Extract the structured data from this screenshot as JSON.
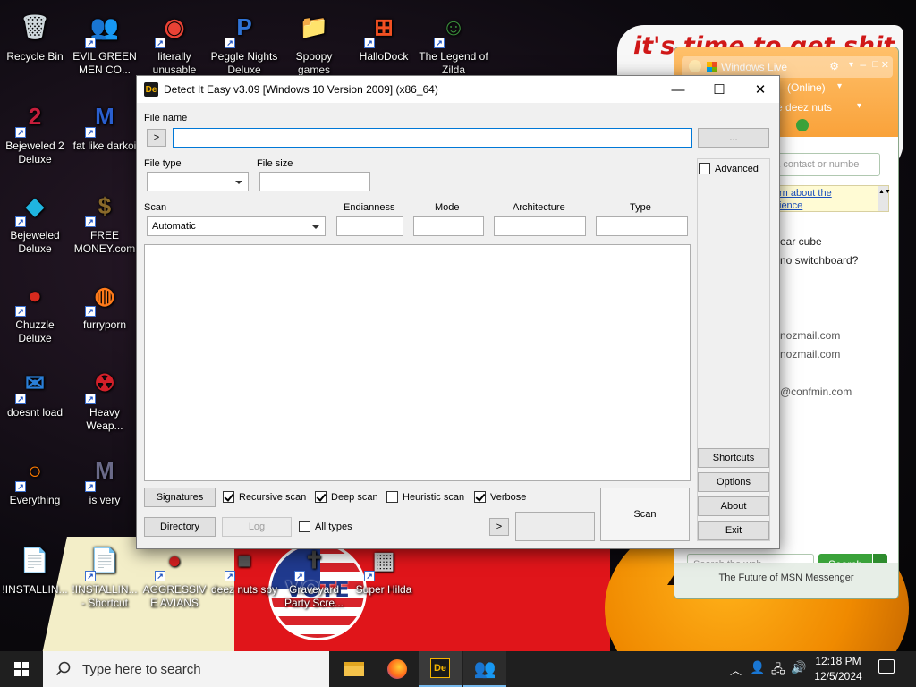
{
  "wallpaper": {
    "slogan": "it's time to get shit",
    "poster_text": "VOTE"
  },
  "desktop_icons": [
    {
      "id": "recycle-bin",
      "label": "Recycle Bin",
      "glyph": "🗑",
      "color": "#cfd8dc",
      "shortcut": false
    },
    {
      "id": "evil-green-men",
      "label": "EVIL GREEN MEN CO...",
      "glyph": "👥",
      "color": "#3cb34a",
      "shortcut": true
    },
    {
      "id": "chrome",
      "label": "literally unusable",
      "glyph": "◉",
      "color": "#e94235",
      "shortcut": true
    },
    {
      "id": "peggle",
      "label": "Peggle Nights Deluxe",
      "glyph": "P",
      "color": "#2f73d6",
      "shortcut": true
    },
    {
      "id": "spoopy",
      "label": "Spoopy games",
      "glyph": "📁",
      "color": "#e4a836",
      "shortcut": false
    },
    {
      "id": "hallodock",
      "label": "HalloDock",
      "glyph": "⊞",
      "color": "#f25022",
      "shortcut": true
    },
    {
      "id": "zilda",
      "label": "The Legend of Zilda",
      "glyph": "☺",
      "color": "#3a8d3a",
      "shortcut": true
    },
    {
      "id": "bejeweled2",
      "label": "Bejeweled 2 Deluxe",
      "glyph": "2",
      "color": "#c81e3c",
      "shortcut": true
    },
    {
      "id": "fat-like",
      "label": "fat like darkoi",
      "glyph": "M",
      "color": "#2a5fd0",
      "shortcut": true
    },
    {
      "id": "bejeweled",
      "label": "Bejeweled Deluxe",
      "glyph": "◆",
      "color": "#1fb5e0",
      "shortcut": true
    },
    {
      "id": "free-money",
      "label": "FREE MONEY.com",
      "glyph": "$",
      "color": "#8a6a2a",
      "shortcut": true
    },
    {
      "id": "chuzzle",
      "label": "Chuzzle Deluxe",
      "glyph": "●",
      "color": "#d62a1e",
      "shortcut": true
    },
    {
      "id": "furryporn",
      "label": "furryporn",
      "glyph": "◍",
      "color": "#ff7a1a",
      "shortcut": true
    },
    {
      "id": "doesnt-load",
      "label": "doesnt load",
      "glyph": "✉",
      "color": "#2a7fd8",
      "shortcut": true
    },
    {
      "id": "heavy-weap",
      "label": "Heavy Weap...",
      "glyph": "☢",
      "color": "#d4202a",
      "shortcut": true
    },
    {
      "id": "everything",
      "label": "Everything",
      "glyph": "○",
      "color": "#ff7b00",
      "shortcut": true
    },
    {
      "id": "is-very",
      "label": "is very",
      "glyph": "M",
      "color": "#6a6a88",
      "shortcut": true
    },
    {
      "id": "installing1",
      "label": "!INSTALLIN...",
      "glyph": "📄",
      "color": "#f2f2f2",
      "shortcut": false
    },
    {
      "id": "installing2",
      "label": "!INSTALLIN... - Shortcut",
      "glyph": "📄",
      "color": "#f2f2f2",
      "shortcut": true
    },
    {
      "id": "aggressive-avians",
      "label": "AGGRESSIVE AVIANS",
      "glyph": "●",
      "color": "#d42020",
      "shortcut": true
    },
    {
      "id": "deez-nuts-spy",
      "label": "deez nuts spy",
      "glyph": "■",
      "color": "#555555",
      "shortcut": true
    },
    {
      "id": "graveyard",
      "label": "Graveyard Party Scre...",
      "glyph": "✝",
      "color": "#444444",
      "shortcut": true
    },
    {
      "id": "super-hilda",
      "label": "Super Hilda",
      "glyph": "▦",
      "color": "#cfcfcf",
      "shortcut": true
    }
  ],
  "die": {
    "title": "Detect It Easy v3.09 [Windows 10 Version 2009] (x86_64)",
    "app_icon_text": "De",
    "file_name_label": "File name",
    "history_button": ">",
    "file_name_value": "",
    "browse_button": "...",
    "file_type_label": "File type",
    "file_type_value": "",
    "file_size_label": "File size",
    "file_size_value": "",
    "advanced_label": "Advanced",
    "scan_label": "Scan",
    "scan_mode_value": "Automatic",
    "endianness_label": "Endianness",
    "endianness_value": "",
    "mode_label": "Mode",
    "mode_value": "",
    "architecture_label": "Architecture",
    "architecture_value": "",
    "type_label": "Type",
    "type_value": "",
    "signatures_button": "Signatures",
    "recursive_scan": {
      "label": "Recursive scan",
      "checked": true
    },
    "deep_scan": {
      "label": "Deep scan",
      "checked": true
    },
    "heuristic_scan": {
      "label": "Heuristic scan",
      "checked": false
    },
    "verbose": {
      "label": "Verbose",
      "checked": true
    },
    "directory_button": "Directory",
    "log_button": "Log",
    "all_types": {
      "label": "All types",
      "checked": false
    },
    "progress_button": ">",
    "scan_button": "Scan",
    "shortcuts_button": "Shortcuts",
    "options_button": "Options",
    "about_button": "About",
    "exit_button": "Exit"
  },
  "msn": {
    "brand": "Windows Live",
    "status": "(Online)",
    "personal_message": "ate deez nuts",
    "search_contact_placeholder": "d a contact or numbe",
    "info_link_1": "rn about the",
    "info_link_2": "ience",
    "contacts": [
      "ear cube",
      "no switchboard?",
      "nozmail.com",
      "nozmail.com",
      "@confmin.com"
    ],
    "web_search_placeholder": "Search the web...",
    "web_search_button": "Search",
    "footer": "The Future of MSN Messenger"
  },
  "taskbar": {
    "search_placeholder": "Type here to search",
    "time": "12:18 PM",
    "date": "12/5/2024"
  },
  "colors": {
    "accent": "#0078d7",
    "msn_orange": "#f9a23a",
    "msn_green": "#3aa23a"
  }
}
